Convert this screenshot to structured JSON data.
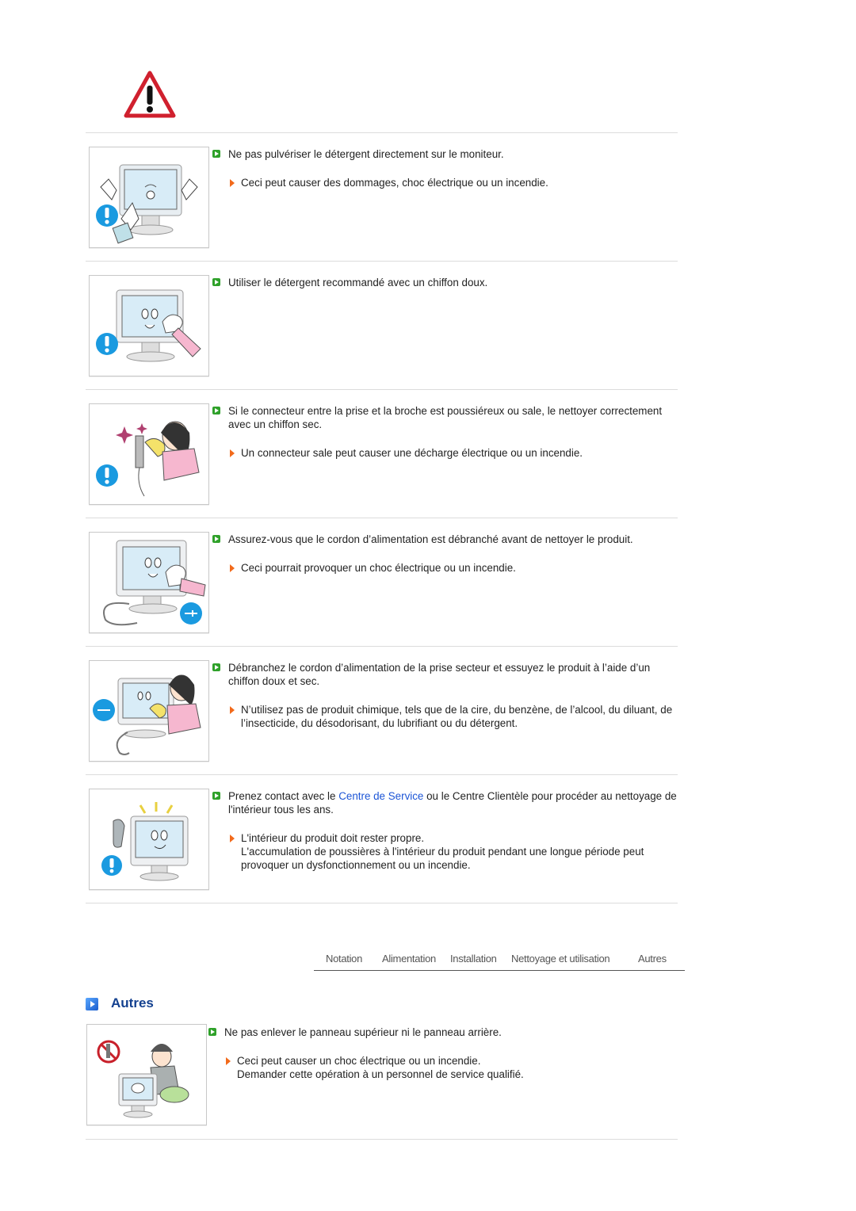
{
  "header": {
    "warning_icon": "warning-triangle-icon"
  },
  "items": [
    {
      "image": "monitor-spray-prohibited-illustration",
      "main": "Ne pas pulvériser le détergent directement sur le moniteur.",
      "subs": [
        "Ceci peut causer des dommages, choc électrique ou un incendie."
      ]
    },
    {
      "image": "monitor-soft-cloth-illustration",
      "main": "Utiliser le détergent recommandé avec un chiffon doux.",
      "subs": []
    },
    {
      "image": "plug-cleaning-illustration",
      "main": "Si le connecteur entre la prise et la broche est poussiéreux ou sale, le nettoyer correctement avec un chiffon sec.",
      "subs": [
        "Un connecteur sale peut causer une décharge électrique ou un incendie."
      ]
    },
    {
      "image": "monitor-unplugged-cleaning-illustration",
      "main": "Assurez-vous que le cordon d’alimentation est débranché avant de nettoyer le produit.",
      "subs": [
        "Ceci pourrait provoquer un choc électrique ou un incendie."
      ]
    },
    {
      "image": "unplug-wipe-illustration",
      "main": "Débranchez le cordon d’alimentation de la prise secteur et essuyez le produit à l’aide d’un chiffon doux et sec.",
      "subs": [
        "N’utilisez pas de produit chimique, tels que de la cire, du benzène, de l’alcool, du diluant, de l’insecticide, du désodorisant, du lubrifiant ou du détergent."
      ]
    },
    {
      "image": "service-center-phone-illustration",
      "main_before": "Prenez contact avec le ",
      "main_link": "Centre de Service",
      "main_after": " ou le Centre Clientèle pour procéder au nettoyage de l'intérieur tous les ans.",
      "subs": [
        "L'intérieur du produit doit rester propre.",
        "L'accumulation de poussières à l'intérieur du produit pendant une longue période peut provoquer un dysfonctionnement ou un incendie."
      ]
    }
  ],
  "nav": {
    "tabs": [
      "Notation",
      "Alimentation",
      "Installation",
      "Nettoyage et utilisation",
      "Autres"
    ]
  },
  "section": {
    "title": "Autres",
    "item": {
      "image": "do-not-disassemble-illustration",
      "main": "Ne pas enlever le panneau supérieur ni le panneau arrière.",
      "subs": [
        "Ceci peut causer un choc électrique ou un incendie.",
        "Demander cette opération à un personnel de service qualifié."
      ]
    }
  },
  "colors": {
    "link": "#1c55d6",
    "section_title": "#13408f",
    "green_bullet": "#2fa12a",
    "orange_arrow": "#f26a1b",
    "warning_red": "#d0202e"
  }
}
